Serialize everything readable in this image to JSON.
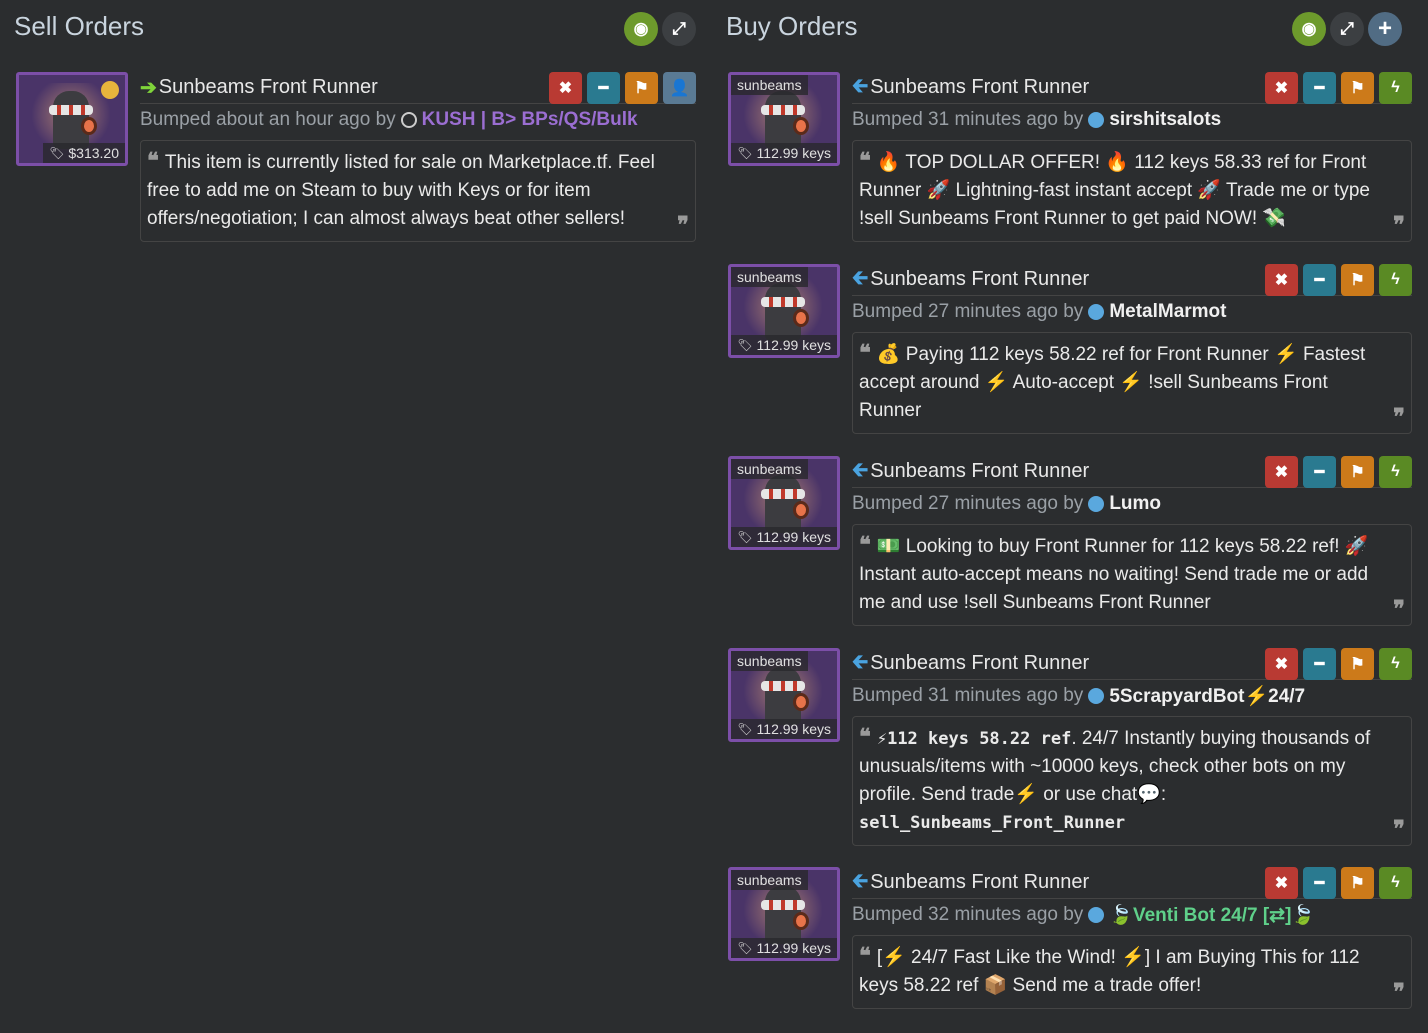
{
  "sell": {
    "title": "Sell Orders",
    "listings": [
      {
        "item": "Sunbeams Front Runner",
        "price": "$313.20",
        "bumped": "Bumped about an hour ago by",
        "user": "KUSH | B> BPs/QS/Bulk",
        "desc": "This item is currently listed for sale on Marketplace.tf. Feel free to add me on Steam to buy with Keys or for item offers/negotiation; I can almost always beat other sellers!"
      }
    ]
  },
  "buy": {
    "title": "Buy Orders",
    "listings": [
      {
        "tag": "sunbeams",
        "item": "Sunbeams Front Runner",
        "price": "112.99 keys",
        "bumped": "Bumped 31 minutes ago by",
        "user": "sirshitsalots",
        "desc": "🔥 TOP DOLLAR OFFER! 🔥 112 keys 58.33 ref for Front Runner 🚀 Lightning-fast instant accept 🚀 Trade me or type !sell Sunbeams Front Runner to get paid NOW! 💸"
      },
      {
        "tag": "sunbeams",
        "item": "Sunbeams Front Runner",
        "price": "112.99 keys",
        "bumped": "Bumped 27 minutes ago by",
        "user": "MetalMarmot",
        "desc": "💰 Paying 112 keys 58.22 ref for Front Runner ⚡ Fastest accept around ⚡ Auto-accept ⚡ !sell Sunbeams Front Runner"
      },
      {
        "tag": "sunbeams",
        "item": "Sunbeams Front Runner",
        "price": "112.99 keys",
        "bumped": "Bumped 27 minutes ago by",
        "user": "Lumo",
        "desc": "💵 Looking to buy Front Runner for 112 keys 58.22 ref! 🚀 Instant auto-accept means no waiting! Send trade me or add me and use !sell Sunbeams Front Runner"
      },
      {
        "tag": "sunbeams",
        "item": "Sunbeams Front Runner",
        "price": "112.99 keys",
        "bumped": "Bumped 31 minutes ago by",
        "user": "5ScrapyardBot⚡24/7",
        "desc_bold": "⚡112 keys 58.22 ref",
        "desc": ". 24/7 Instantly buying thousands of unusuals/items with ~10000 keys, check other bots on my profile. Send trade⚡ or use chat💬:",
        "desc_code": "sell_Sunbeams_Front_Runner"
      },
      {
        "tag": "sunbeams",
        "item": "Sunbeams Front Runner",
        "price": "112.99 keys",
        "bumped": "Bumped 32 minutes ago by",
        "user": "🍃Venti Bot 24/7 [⇄]🍃",
        "desc": "[⚡ 24/7 Fast Like the Wind! ⚡] I am Buying This for 112 keys 58.22 ref 📦 Send me a trade offer!"
      }
    ]
  }
}
